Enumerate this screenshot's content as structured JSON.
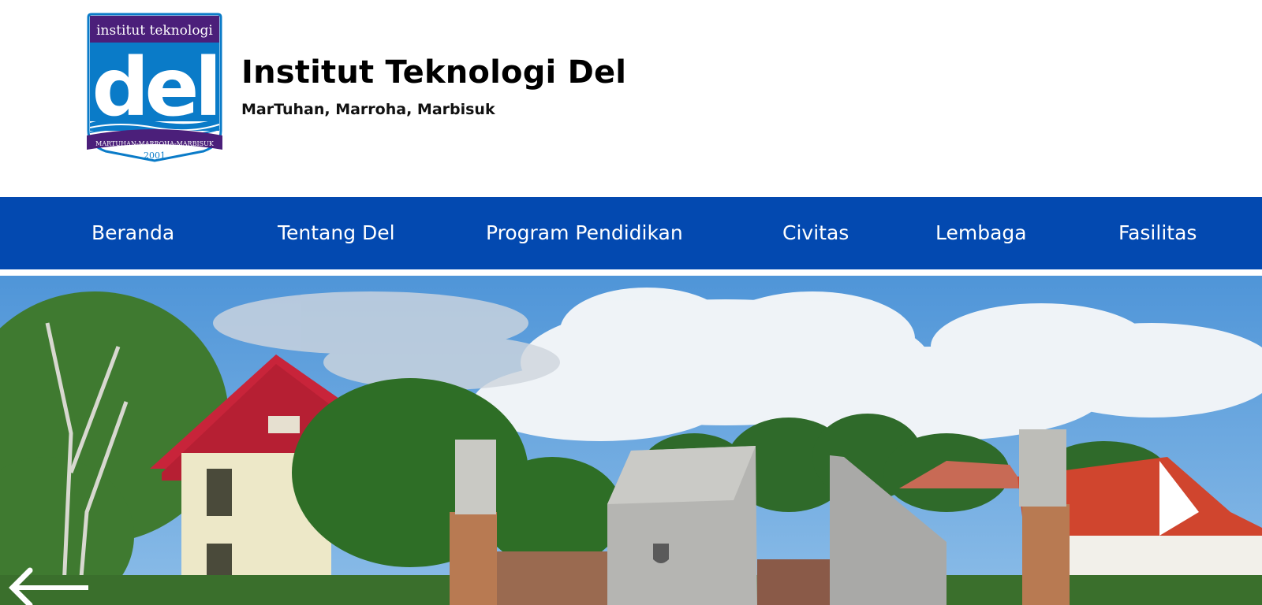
{
  "header": {
    "logo": {
      "top_text": "institut teknologi",
      "word": "del",
      "ribbon_text": "MARTUHAN-MARROHA-MARBISUK",
      "year": "2001"
    },
    "title": "Institut Teknologi Del",
    "tagline": "MarTuhan, Marroha, Marbisuk"
  },
  "nav": {
    "items": [
      {
        "label": "Beranda"
      },
      {
        "label": "Tentang Del"
      },
      {
        "label": "Program Pendidikan"
      },
      {
        "label": "Civitas"
      },
      {
        "label": "Lembaga"
      },
      {
        "label": "Fasilitas"
      }
    ]
  },
  "hero": {
    "prev_icon": "arrow-left-icon"
  },
  "colors": {
    "nav_bg": "#0349b0",
    "logo_blue": "#0a7bc8",
    "logo_purple": "#4b1f7a",
    "roof_red": "#c8243a",
    "sky": "#5aa0dc"
  }
}
